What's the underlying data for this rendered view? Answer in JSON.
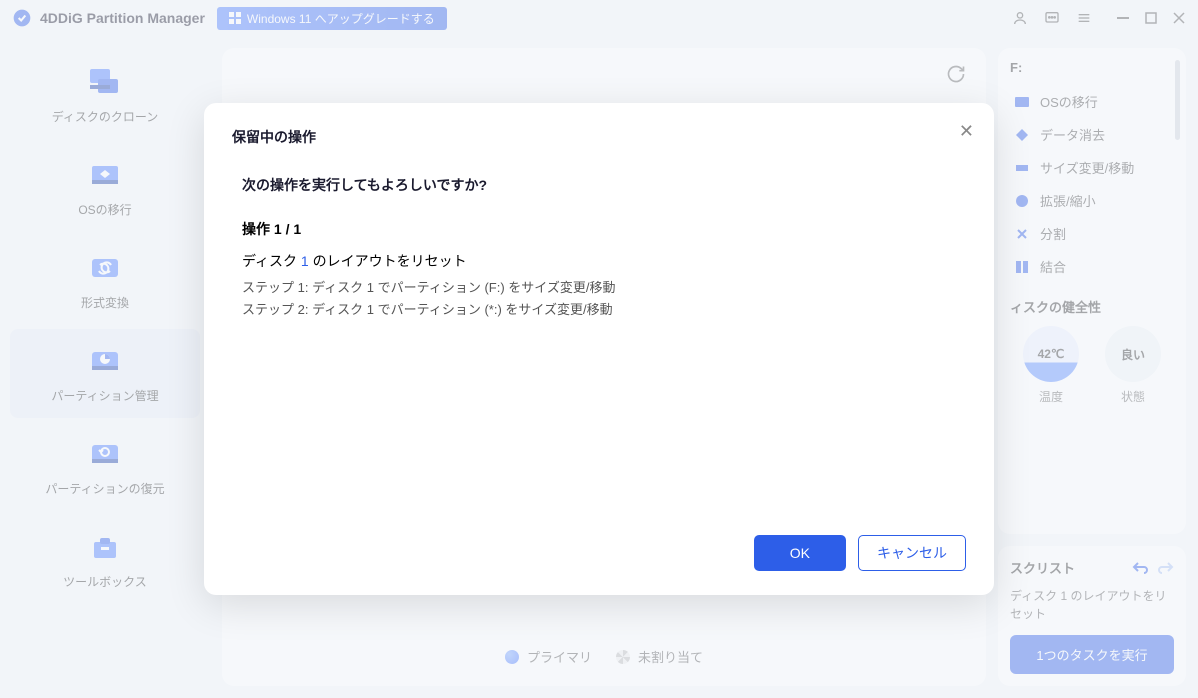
{
  "titlebar": {
    "app_name": "4DDiG Partition Manager",
    "upgrade_label": "Windows 11 へアップグレードする"
  },
  "sidebar": {
    "items": [
      {
        "label": "ディスクのクローン",
        "icon": "disk-clone"
      },
      {
        "label": "OSの移行",
        "icon": "os-migrate"
      },
      {
        "label": "形式変換",
        "icon": "format-convert"
      },
      {
        "label": "パーティション管理",
        "icon": "partition-manage",
        "active": true
      },
      {
        "label": "パーティションの復元",
        "icon": "partition-recover"
      },
      {
        "label": "ツールボックス",
        "icon": "toolbox"
      }
    ]
  },
  "legend": {
    "primary": "プライマリ",
    "unallocated": "未割り当て"
  },
  "right": {
    "drive_label": "F:",
    "actions": [
      {
        "label": "OSの移行",
        "icon": "migrate"
      },
      {
        "label": "データ消去",
        "icon": "erase"
      },
      {
        "label": "サイズ変更/移動",
        "icon": "resize"
      },
      {
        "label": "拡張/縮小",
        "icon": "extend"
      },
      {
        "label": "分割",
        "icon": "split"
      },
      {
        "label": "結合",
        "icon": "merge"
      }
    ],
    "health": {
      "title": "ィスクの健全性",
      "temp_value": "42℃",
      "temp_label": "温度",
      "status_value": "良い",
      "status_label": "状態"
    },
    "tasks": {
      "title": "スクリスト",
      "item": "ディスク 1 のレイアウトをリセット",
      "execute": "1つのタスクを実行"
    }
  },
  "modal": {
    "title": "保留中の操作",
    "question": "次の操作を実行してもよろしいですか?",
    "op_count": "操作 1 / 1",
    "subtitle_pre": "ディスク ",
    "subtitle_num": "1",
    "subtitle_post": " のレイアウトをリセット",
    "step1": "ステップ 1: ディスク 1 でパーティション (F:) をサイズ変更/移動",
    "step2": "ステップ 2: ディスク 1 でパーティション (*:) をサイズ変更/移動",
    "ok": "OK",
    "cancel": "キャンセル"
  }
}
